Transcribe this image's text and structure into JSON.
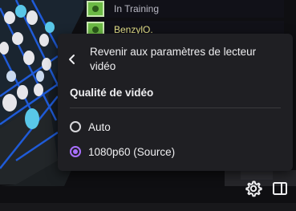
{
  "overlay": {
    "cards": [
      {
        "text": "In Training"
      },
      {
        "text": "BenzylO."
      }
    ]
  },
  "settings_menu": {
    "back_label": "Revenir aux paramètres de lecteur vidéo",
    "section_title": "Qualité de vidéo",
    "options": [
      {
        "label": "Auto",
        "selected": false
      },
      {
        "label": "1080p60 (Source)",
        "selected": true
      }
    ]
  },
  "icons": {
    "back": "chevron-left-icon",
    "settings": "gear-icon",
    "theatre": "sidebar-panel-icon"
  },
  "colors": {
    "accent": "#a970ff",
    "menu_bg": "#1f1f23",
    "text": "#efeff1"
  }
}
